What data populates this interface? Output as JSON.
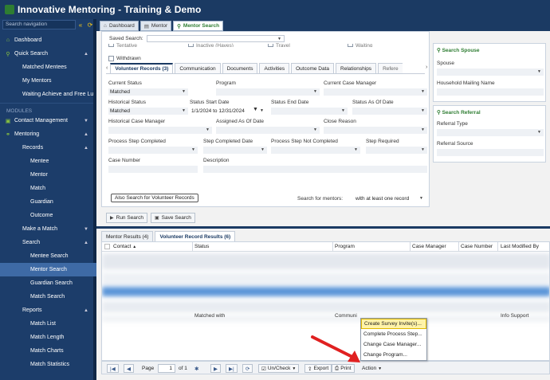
{
  "app": {
    "title": "Innovative Mentoring - Training & Demo"
  },
  "window_tabs": [
    {
      "label": "Dashboard",
      "icon": "home-icon"
    },
    {
      "label": "Mentor",
      "icon": "document-icon"
    },
    {
      "label": "Mentor Search",
      "icon": "search-icon"
    }
  ],
  "sidebar": {
    "search_placeholder": "Search navigation",
    "dashboard": "Dashboard",
    "quick_search": "Quick Search",
    "matched_mentees": "Matched Mentees",
    "my_mentors": "My Mentors",
    "waiting": "Waiting Achieve and Free Lu",
    "modules": "MODULES",
    "contact_management": "Contact Management",
    "mentoring": "Mentoring",
    "records": "Records",
    "mentee": "Mentee",
    "mentor": "Mentor",
    "match": "Match",
    "guardian": "Guardian",
    "outcome": "Outcome",
    "make_a_match": "Make a Match",
    "search": "Search",
    "mentee_search": "Mentee Search",
    "mentor_search": "Mentor Search",
    "guardian_search": "Guardian Search",
    "match_search": "Match Search",
    "reports": "Reports",
    "match_list": "Match List",
    "match_length": "Match Length",
    "match_charts": "Match Charts",
    "match_statistics": "Match Statistics"
  },
  "search": {
    "saved_search_label": "Saved Search:",
    "partial_checkboxes": [
      "Tentative",
      "Inactive (Hayes)",
      "Travel",
      "Waiting"
    ],
    "withdrawn": "Withdrawn",
    "subtabs": [
      "Volunteer Records (3)",
      "Communication",
      "Documents",
      "Activities",
      "Outcome Data",
      "Relationships",
      "Refere"
    ],
    "fields": {
      "current_status": "Current Status",
      "current_status_value": "Matched",
      "program": "Program",
      "current_case_manager": "Current Case Manager",
      "historical_status": "Historical Status",
      "historical_status_value": "Matched",
      "status_start_date": "Status Start Date",
      "status_start_date_value": "1/1/2024 to 12/31/2024",
      "status_end_date": "Status End Date",
      "status_as_of_date": "Status As Of Date",
      "historical_case_manager": "Historical Case Manager",
      "assigned_as_of_date": "Assigned As Of Date",
      "close_reason": "Close Reason",
      "process_step_completed": "Process Step Completed",
      "step_completed_date": "Step Completed Date",
      "process_step_not_completed": "Process Step Not Completed",
      "step_required": "Step Required",
      "case_number": "Case Number",
      "description": "Description"
    },
    "also_search_button": "Also Search for Volunteer Records",
    "search_for_mentors_label": "Search for mentors:",
    "search_for_mentors_value": "with at least one record",
    "run_search": "Run Search",
    "save_search": "Save Search"
  },
  "right_panel": {
    "spouse_header": "Search Spouse",
    "spouse": "Spouse",
    "household_mailing_name": "Household Mailing Name",
    "referral_header": "Search Referral",
    "referral_type": "Referral Type",
    "referral_source": "Referral Source"
  },
  "results": {
    "tabs": [
      "Mentor Results (4)",
      "Volunteer Record Results (6)"
    ],
    "columns": [
      "Contact",
      "Status",
      "Program",
      "Case Manager",
      "Case Number",
      "Last Modified By"
    ],
    "visible_fragments": [
      "Matched with",
      "Communi",
      "Info Support"
    ]
  },
  "pager": {
    "page_label": "Page",
    "page_value": "1",
    "of_label": "of 1",
    "uncheck": "Un/Check",
    "export": "Export",
    "print": "Print",
    "action": "Action"
  },
  "action_menu": {
    "items": [
      "Create Survey Invite(s)...",
      "Complete Process Step...",
      "Change Case Manager...",
      "Change Program..."
    ]
  },
  "colors": {
    "header_bg": "#1b3a63",
    "sidebar_bg": "#1c3d6a",
    "accent_green": "#2e7d32",
    "highlight": "#fff3a8",
    "arrow_red": "#e02020"
  }
}
